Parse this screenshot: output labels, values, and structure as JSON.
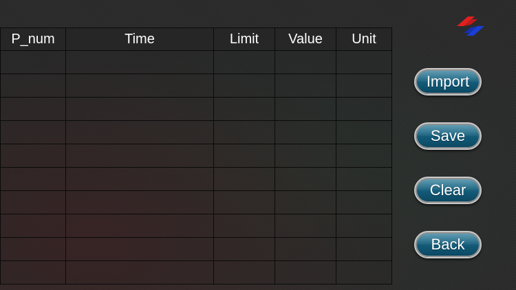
{
  "table": {
    "columns": [
      "P_num",
      "Time",
      "Limit",
      "Value",
      "Unit"
    ],
    "rows": [
      [
        "",
        "",
        "",
        "",
        ""
      ],
      [
        "",
        "",
        "",
        "",
        ""
      ],
      [
        "",
        "",
        "",
        "",
        ""
      ],
      [
        "",
        "",
        "",
        "",
        ""
      ],
      [
        "",
        "",
        "",
        "",
        ""
      ],
      [
        "",
        "",
        "",
        "",
        ""
      ],
      [
        "",
        "",
        "",
        "",
        ""
      ],
      [
        "",
        "",
        "",
        "",
        ""
      ],
      [
        "",
        "",
        "",
        "",
        ""
      ],
      [
        "",
        "",
        "",
        "",
        ""
      ]
    ]
  },
  "buttons": {
    "import": "Import",
    "save": "Save",
    "clear": "Clear",
    "back": "Back"
  },
  "logo": {
    "icon": "brand-logo-icon",
    "colors": [
      "#e02020",
      "#1a3fd6"
    ]
  }
}
